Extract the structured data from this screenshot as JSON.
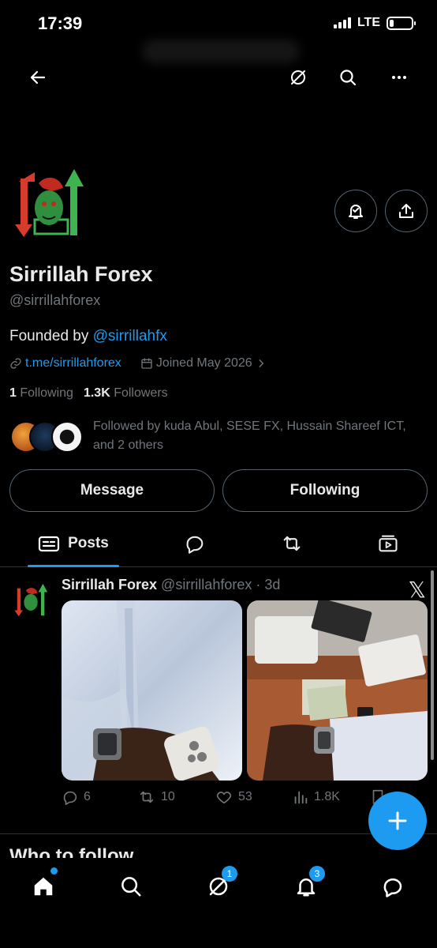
{
  "status_bar": {
    "time": "17:39",
    "network": "LTE",
    "battery_level": 0.2
  },
  "profile": {
    "name": "Sirrillah Forex",
    "handle": "@sirrillahforex",
    "bio_prefix": "Founded by ",
    "bio_mention": "@sirrillahfx",
    "website": "t.me/sirrillahforex",
    "joined": "Joined May 2026",
    "following_count": "1",
    "following_label": "Following",
    "followers_count": "1.3K",
    "followers_label": "Followers",
    "followed_by": "Followed by kuda Abul, SESE FX, Hussain Shareef ICT, and 2 others"
  },
  "buttons": {
    "message": "Message",
    "following": "Following"
  },
  "tabs": [
    {
      "label": "Posts",
      "icon": "posts-icon",
      "active": true
    },
    {
      "label": "",
      "icon": "replies-icon"
    },
    {
      "label": "",
      "icon": "reposts-icon"
    },
    {
      "label": "",
      "icon": "media-icon"
    }
  ],
  "post": {
    "author": "Sirrillah Forex",
    "handle_time": "@sirrillahforex · 3d",
    "x_logo": "𝕏",
    "replies": "6",
    "reposts": "10",
    "likes": "53",
    "views": "1.8K"
  },
  "section_title": "Who to follow",
  "bottom_nav": {
    "messages_badge": "1",
    "notifications_badge": "3"
  },
  "colors": {
    "accent": "#1d9bf0",
    "background": "#000000",
    "muted": "#71767b"
  }
}
